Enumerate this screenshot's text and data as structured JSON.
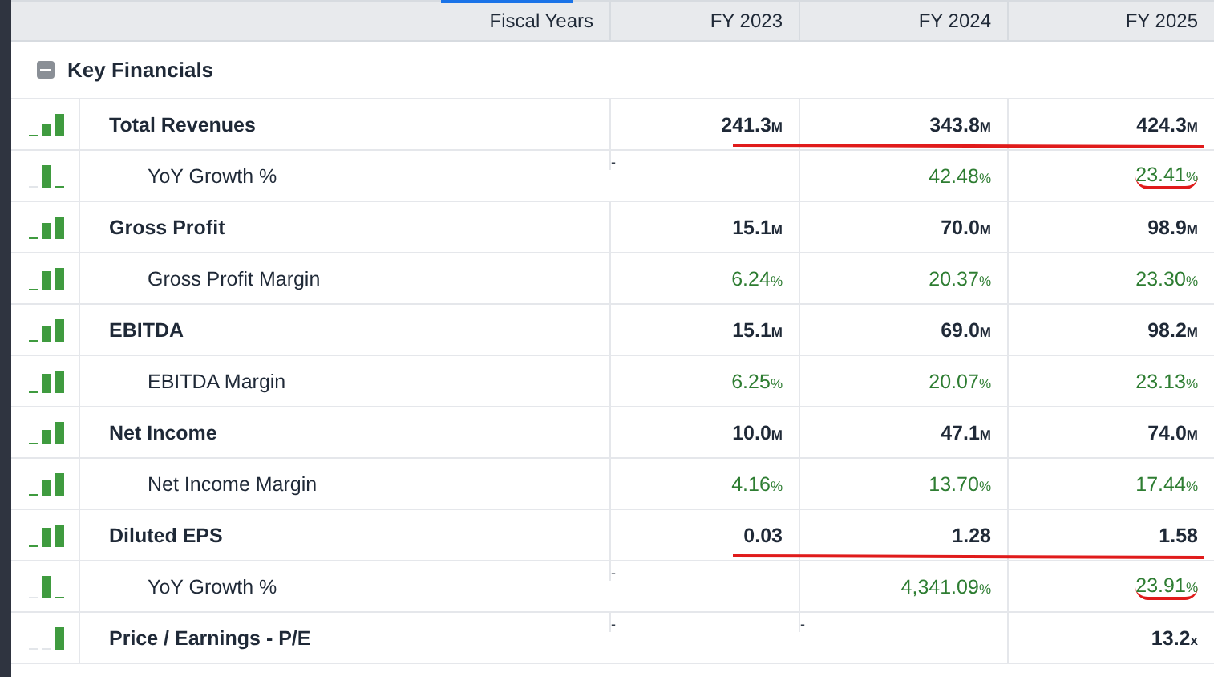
{
  "table": {
    "row_header": "Fiscal Years",
    "columns": [
      "FY 2023",
      "FY 2024",
      "FY 2025"
    ],
    "section": {
      "title": "Key Financials",
      "expanded": true
    },
    "rows": [
      {
        "label": "Total Revenues",
        "underline": true,
        "cells": [
          {
            "kind": "amount",
            "value": "241.3",
            "unit": "M"
          },
          {
            "kind": "amount",
            "value": "343.8",
            "unit": "M"
          },
          {
            "kind": "amount",
            "value": "424.3",
            "unit": "M"
          }
        ],
        "children": [
          {
            "label": "YoY Growth %",
            "cells": [
              {
                "kind": "dash",
                "value": "-"
              },
              {
                "kind": "percent",
                "value": "42.48",
                "unit": "%"
              },
              {
                "kind": "percent",
                "value": "23.41",
                "unit": "%",
                "underlined": true
              }
            ]
          }
        ]
      },
      {
        "label": "Gross Profit",
        "cells": [
          {
            "kind": "amount",
            "value": "15.1",
            "unit": "M"
          },
          {
            "kind": "amount",
            "value": "70.0",
            "unit": "M"
          },
          {
            "kind": "amount",
            "value": "98.9",
            "unit": "M"
          }
        ],
        "children": [
          {
            "label": "Gross Profit Margin",
            "cells": [
              {
                "kind": "percent",
                "value": "6.24",
                "unit": "%"
              },
              {
                "kind": "percent",
                "value": "20.37",
                "unit": "%"
              },
              {
                "kind": "percent",
                "value": "23.30",
                "unit": "%"
              }
            ]
          }
        ]
      },
      {
        "label": "EBITDA",
        "cells": [
          {
            "kind": "amount",
            "value": "15.1",
            "unit": "M"
          },
          {
            "kind": "amount",
            "value": "69.0",
            "unit": "M"
          },
          {
            "kind": "amount",
            "value": "98.2",
            "unit": "M"
          }
        ],
        "children": [
          {
            "label": "EBITDA Margin",
            "cells": [
              {
                "kind": "percent",
                "value": "6.25",
                "unit": "%"
              },
              {
                "kind": "percent",
                "value": "20.07",
                "unit": "%"
              },
              {
                "kind": "percent",
                "value": "23.13",
                "unit": "%"
              }
            ]
          }
        ]
      },
      {
        "label": "Net Income",
        "cells": [
          {
            "kind": "amount",
            "value": "10.0",
            "unit": "M"
          },
          {
            "kind": "amount",
            "value": "47.1",
            "unit": "M"
          },
          {
            "kind": "amount",
            "value": "74.0",
            "unit": "M"
          }
        ],
        "children": [
          {
            "label": "Net Income Margin",
            "cells": [
              {
                "kind": "percent",
                "value": "4.16",
                "unit": "%"
              },
              {
                "kind": "percent",
                "value": "13.70",
                "unit": "%"
              },
              {
                "kind": "percent",
                "value": "17.44",
                "unit": "%"
              }
            ]
          }
        ]
      },
      {
        "label": "Diluted EPS",
        "underline": true,
        "cells": [
          {
            "kind": "amount",
            "value": "0.03"
          },
          {
            "kind": "amount",
            "value": "1.28"
          },
          {
            "kind": "amount",
            "value": "1.58"
          }
        ],
        "children": [
          {
            "label": "YoY Growth %",
            "cells": [
              {
                "kind": "dash",
                "value": "-"
              },
              {
                "kind": "percent",
                "value": "4,341.09",
                "unit": "%"
              },
              {
                "kind": "percent",
                "value": "23.91",
                "unit": "%",
                "underlined": true
              }
            ]
          }
        ]
      },
      {
        "label": "Price / Earnings - P/E",
        "cells": [
          {
            "kind": "dash",
            "value": "-"
          },
          {
            "kind": "dash",
            "value": "-"
          },
          {
            "kind": "amount",
            "value": "13.2",
            "unit": "x"
          }
        ]
      }
    ]
  }
}
